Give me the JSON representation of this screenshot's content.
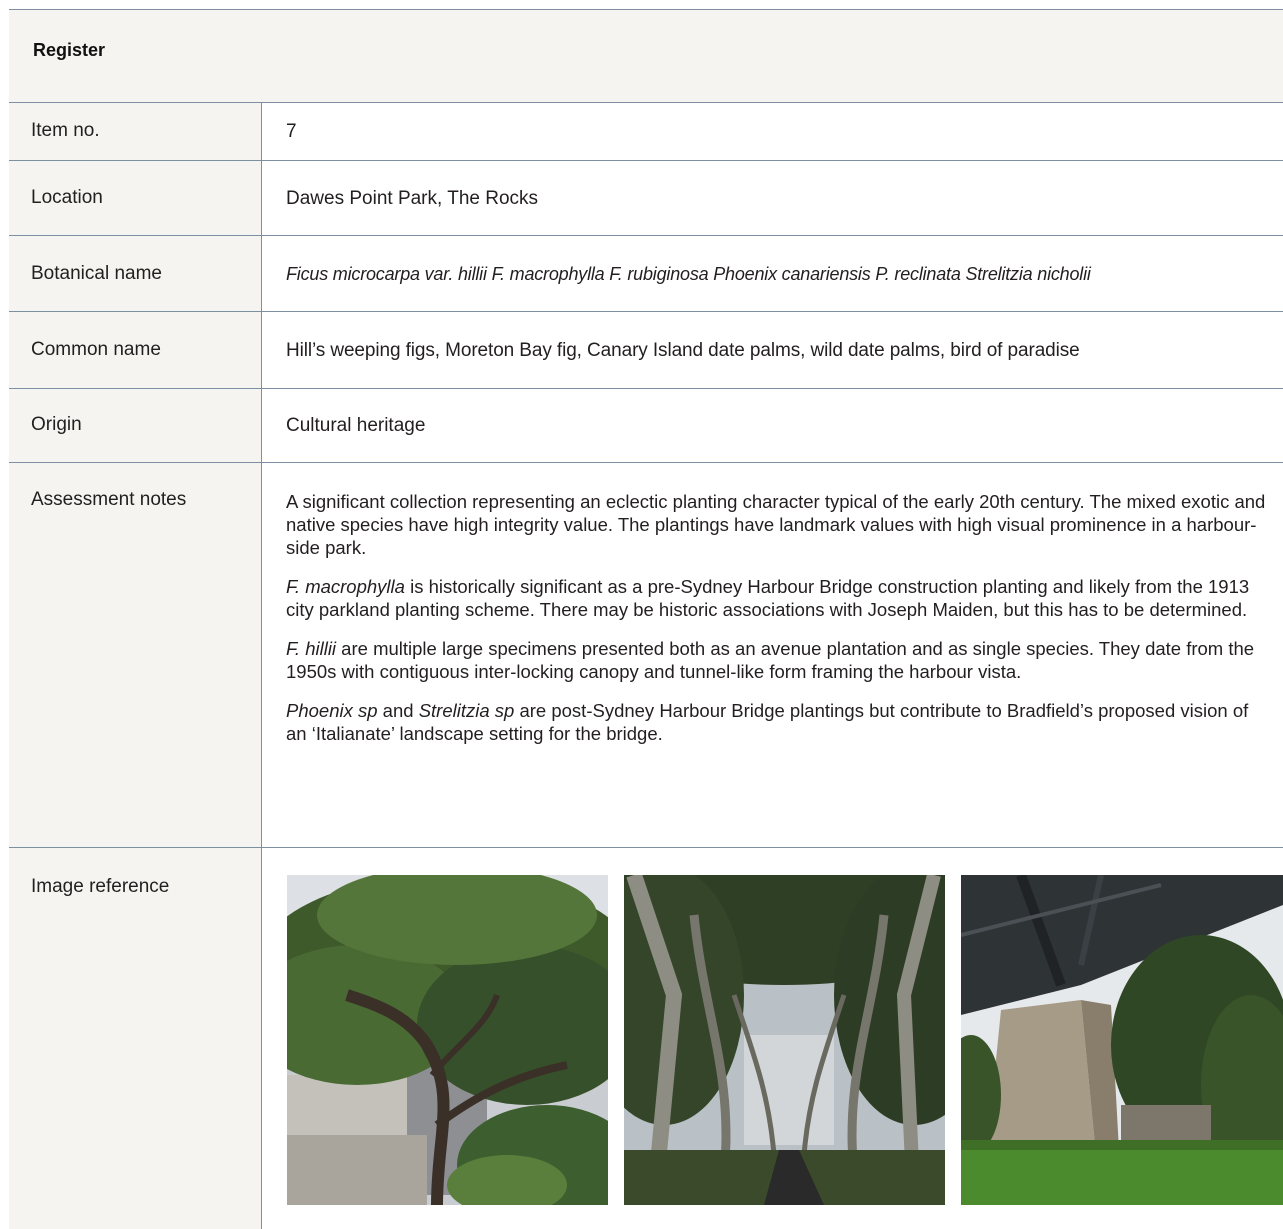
{
  "register": {
    "title": "Register"
  },
  "rows": {
    "item_no": {
      "label": "Item no.",
      "value": "7"
    },
    "location": {
      "label": "Location",
      "value": "Dawes Point Park, The Rocks"
    },
    "botanical_name": {
      "label": "Botanical name",
      "value": "Ficus microcarpa var. hillii F. macrophylla F. rubiginosa Phoenix canariensis P. reclinata Strelitzia nicholii"
    },
    "common_name": {
      "label": "Common name",
      "value": "Hill’s weeping figs, Moreton Bay fig, Canary Island date palms, wild date palms, bird of paradise"
    },
    "origin": {
      "label": "Origin",
      "value": "Cultural heritage"
    },
    "assessment_notes": {
      "label": "Assessment notes",
      "p1": "A significant collection representing an eclectic planting character typical of the early 20th century. The mixed exotic and native species have high integrity value. The plantings have landmark values with high visual prominence in a harbour-side park.",
      "p2_italic": "F. macrophylla",
      "p2_rest": " is historically significant as a pre-Sydney Harbour Bridge construction planting and likely from the 1913 city parkland planting scheme. There may be historic associations with Joseph Maiden, but this has to be determined.",
      "p3_italic": "F. hillii",
      "p3_rest": " are multiple large specimens presented both as an avenue plantation and as single species. They date from the 1950s with contiguous inter-locking canopy and tunnel-like form framing the harbour vista.",
      "p4_italic1": "Phoenix sp",
      "p4_mid": " and ",
      "p4_italic2": "Strelitzia sp",
      "p4_rest": " are post-Sydney Harbour Bridge plantings but contribute to Bradfield’s proposed vision of an ‘Italianate’ landscape setting for the bridge."
    },
    "image_reference": {
      "label": "Image reference"
    }
  },
  "colors": {
    "rule": "#7d8fa0",
    "label_bg": "#f5f4f0",
    "text": "#231f20"
  }
}
